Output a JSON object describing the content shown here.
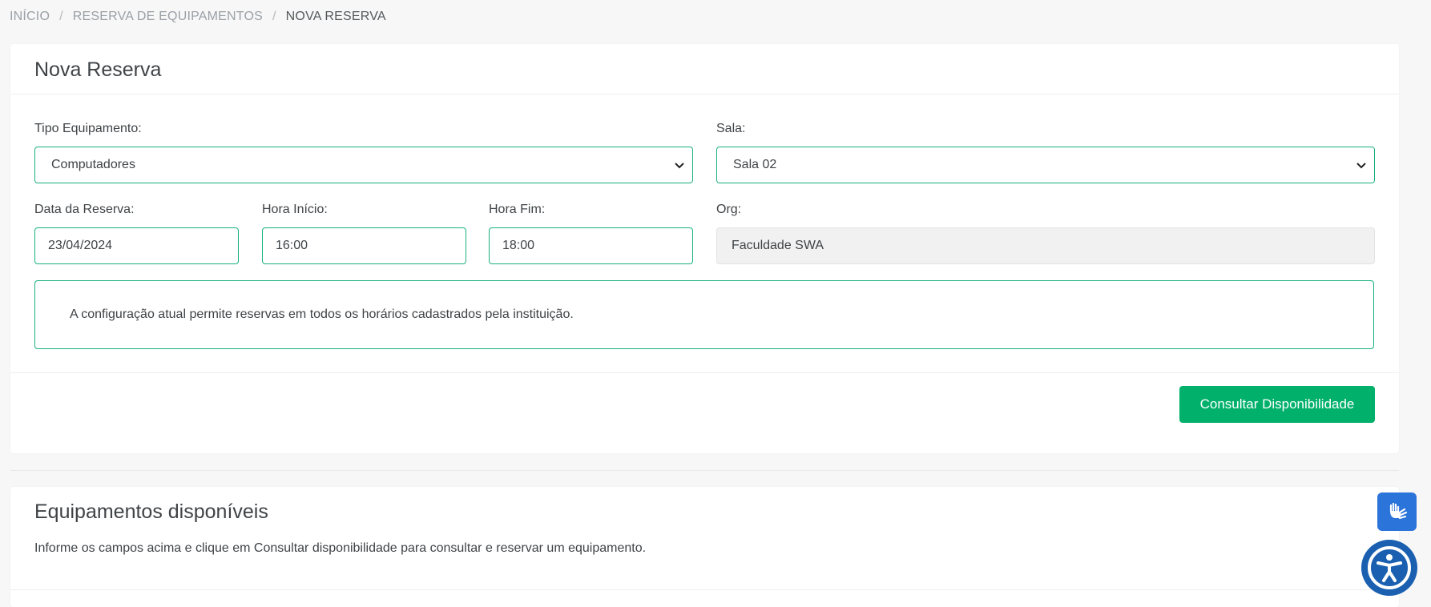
{
  "breadcrumb": {
    "items": [
      "INÍCIO",
      "RESERVA DE EQUIPAMENTOS",
      "NOVA RESERVA"
    ],
    "separator": "/"
  },
  "reserva_card": {
    "title": "Nova Reserva",
    "tipo_equipamento": {
      "label": "Tipo Equipamento:",
      "value": "Computadores"
    },
    "sala": {
      "label": "Sala:",
      "value": "Sala 02"
    },
    "data_reserva": {
      "label": "Data da Reserva:",
      "value": "23/04/2024"
    },
    "hora_inicio": {
      "label": "Hora Início:",
      "value": "16:00"
    },
    "hora_fim": {
      "label": "Hora Fim:",
      "value": "18:00"
    },
    "org": {
      "label": "Org:",
      "value": "Faculdade SWA"
    },
    "info_message": "A configuração atual permite reservas em todos os horários cadastrados pela instituição.",
    "consultar_button": "Consultar Disponibilidade"
  },
  "equipamentos_card": {
    "title": "Equipamentos disponíveis",
    "description": "Informe os campos acima e clique em Consultar disponibilidade para consultar e reservar um equipamento."
  },
  "icons": {
    "libras": "hands-sign-language-icon",
    "accessibility": "accessibility-person-icon",
    "select_chevron": "chevron-down-icon"
  },
  "colors": {
    "accent_border": "#17b07c",
    "primary_button": "#00b06b",
    "libras_button": "#2b74d9",
    "accessibility_button": "#1a5fb0"
  }
}
